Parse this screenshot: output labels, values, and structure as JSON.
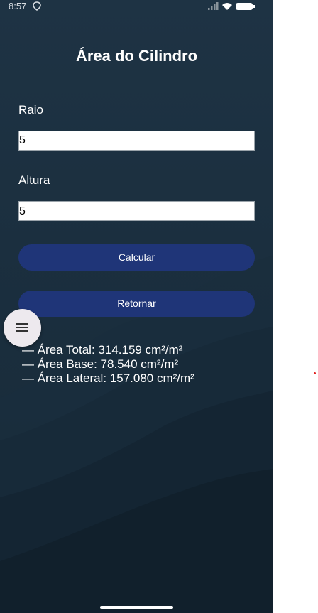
{
  "status_bar": {
    "time": "8:57"
  },
  "page": {
    "title": "Área do Cilindro"
  },
  "form": {
    "radius_label": "Raio",
    "radius_value": "5",
    "height_label": "Altura",
    "height_value": "5"
  },
  "buttons": {
    "calculate_label": "Calcular",
    "return_label": "Retornar"
  },
  "results": [
    "— Área Total: 314.159 cm²/m²",
    "— Área Base: 78.540 cm²/m²",
    "— Área Lateral: 157.080 cm²/m²"
  ],
  "icons": {
    "fab": "menu-icon",
    "status_location": "location-icon",
    "status_signal": "signal-icon",
    "status_wifi": "wifi-icon",
    "status_battery": "battery-icon"
  },
  "colors": {
    "background": "#1b2f3f",
    "button": "#1f3578",
    "fab": "#ede9ee"
  }
}
